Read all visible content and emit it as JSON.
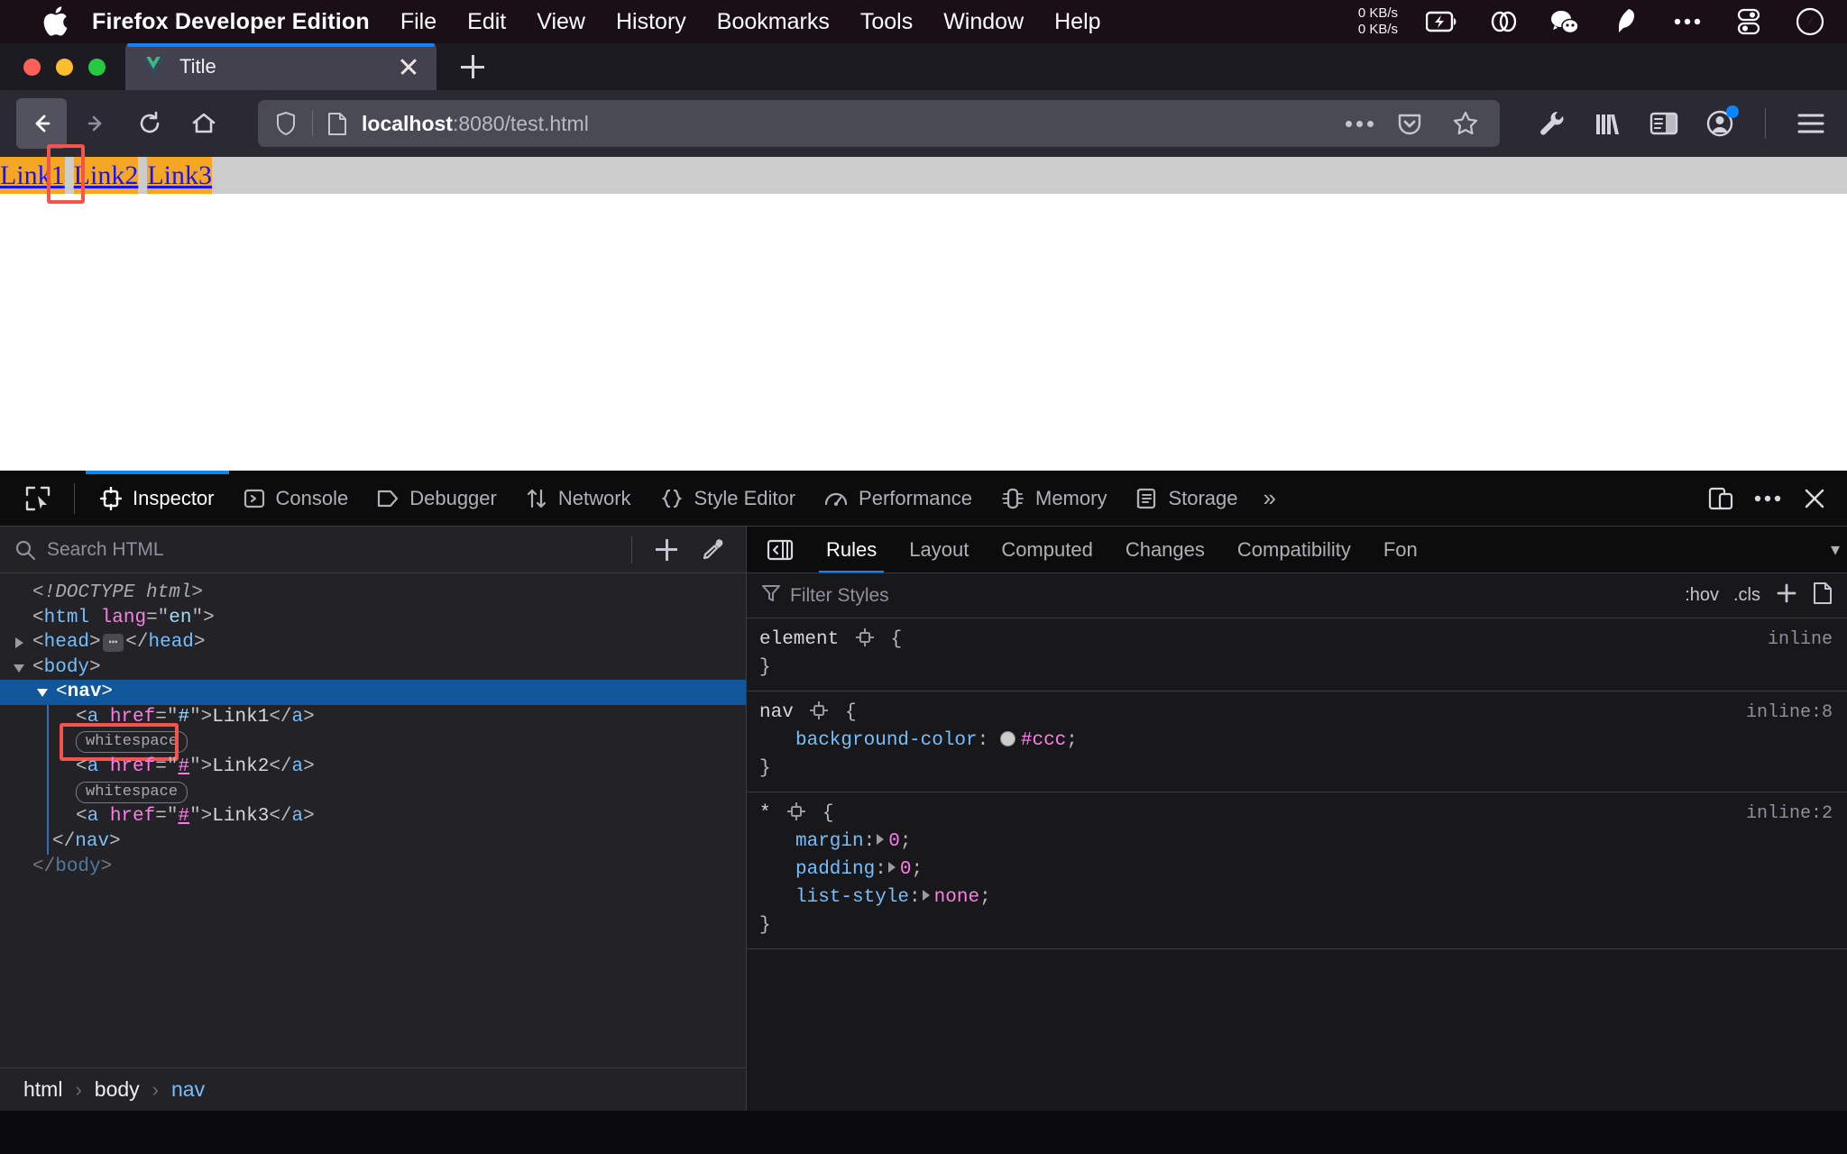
{
  "menubar": {
    "apple_icon": "apple-logo-icon",
    "app_name": "Firefox Developer Edition",
    "items": [
      "File",
      "Edit",
      "View",
      "History",
      "Bookmarks",
      "Tools",
      "Window",
      "Help"
    ],
    "network_up": "0 KB/s",
    "network_down": "0 KB/s",
    "tray_icons": [
      "battery-charging-icon",
      "link-chain-icon",
      "wechat-icon",
      "feather-icon",
      "ellipsis-icon",
      "toggle-stack-icon",
      "control-center-icon"
    ]
  },
  "browser": {
    "tab": {
      "favicon": "vue-logo-icon",
      "title": "Title",
      "close_icon": "close-icon"
    },
    "new_tab_icon": "plus-icon",
    "nav": {
      "back_icon": "arrow-left-icon",
      "forward_icon": "arrow-right-icon",
      "reload_icon": "reload-icon",
      "home_icon": "home-icon"
    },
    "urlbar": {
      "shield_icon": "shield-icon",
      "page_icon": "page-icon",
      "host": "localhost",
      "path": ":8080/test.html",
      "actions": [
        "ellipsis-icon",
        "pocket-icon",
        "star-icon"
      ]
    },
    "toolbar_right": [
      "wrench-icon",
      "library-icon",
      "sidebar-icon",
      "account-icon",
      "hamburger-menu-icon"
    ]
  },
  "page": {
    "nav_background": "#cccccc",
    "link_highlight": "#f5a623",
    "link_color": "#1414ff",
    "links": [
      "Link1",
      "Link2",
      "Link3"
    ],
    "selection_color": "#f4544c"
  },
  "devtools": {
    "picker_icon": "element-picker-icon",
    "tabs": [
      {
        "label": "Inspector",
        "icon": "inspector-icon",
        "active": true
      },
      {
        "label": "Console",
        "icon": "console-icon",
        "active": false
      },
      {
        "label": "Debugger",
        "icon": "debugger-icon",
        "active": false
      },
      {
        "label": "Network",
        "icon": "network-icon",
        "active": false
      },
      {
        "label": "Style Editor",
        "icon": "style-editor-icon",
        "active": false
      },
      {
        "label": "Performance",
        "icon": "performance-icon",
        "active": false
      },
      {
        "label": "Memory",
        "icon": "memory-icon",
        "active": false
      },
      {
        "label": "Storage",
        "icon": "storage-icon",
        "active": false
      }
    ],
    "overflow_icon": "chevron-double-right-icon",
    "right_actions": [
      "responsive-design-icon",
      "meatball-menu-icon",
      "close-icon"
    ],
    "search": {
      "placeholder": "Search HTML",
      "search_icon": "search-icon",
      "add_node_icon": "plus-icon",
      "eyedropper_icon": "eyedropper-icon"
    },
    "markup": [
      {
        "indent": 0,
        "twisty": "none",
        "kind": "doctype",
        "text": "<!DOCTYPE html>"
      },
      {
        "indent": 0,
        "twisty": "none",
        "kind": "open_attr",
        "tag": "html",
        "attr": "lang",
        "value": "en"
      },
      {
        "indent": 0,
        "twisty": "closed",
        "kind": "collapsed",
        "tag": "head"
      },
      {
        "indent": 0,
        "twisty": "open",
        "kind": "open",
        "tag": "body"
      },
      {
        "indent": 1,
        "twisty": "open",
        "kind": "open",
        "tag": "nav",
        "selected": true
      },
      {
        "indent": 2,
        "twisty": "none",
        "kind": "anchor",
        "tag": "a",
        "attr": "href",
        "value": "#",
        "text": "Link1"
      },
      {
        "indent": 2,
        "twisty": "none",
        "kind": "whitespace",
        "label": "whitespace",
        "highlighted": true
      },
      {
        "indent": 2,
        "twisty": "none",
        "kind": "anchor",
        "tag": "a",
        "attr": "href",
        "value": "#",
        "text": "Link2",
        "value_link": true
      },
      {
        "indent": 2,
        "twisty": "none",
        "kind": "whitespace",
        "label": "whitespace",
        "highlighted": false
      },
      {
        "indent": 2,
        "twisty": "none",
        "kind": "anchor",
        "tag": "a",
        "attr": "href",
        "value": "#",
        "text": "Link3"
      },
      {
        "indent": 1,
        "twisty": "none",
        "kind": "close",
        "tag": "nav"
      },
      {
        "indent": 0,
        "twisty": "none",
        "kind": "close",
        "tag": "body"
      }
    ],
    "breadcrumbs": [
      "html",
      "body",
      "nav"
    ],
    "right_panel": {
      "toggle_icon": "panel-toggle-icon",
      "tabs": [
        "Rules",
        "Layout",
        "Computed",
        "Changes",
        "Compatibility",
        "Fon"
      ],
      "active_tab": "Rules",
      "overflow_icon": "chevron-down-icon",
      "filter": {
        "placeholder": "Filter Styles",
        "filter_icon": "funnel-icon",
        "hov": ":hov",
        "cls": ".cls",
        "add_icon": "plus-icon",
        "new_rule_icon": "document-icon"
      },
      "rules": [
        {
          "selector": "element",
          "source": "inline",
          "declarations": []
        },
        {
          "selector": "nav",
          "source": "inline:8",
          "declarations": [
            {
              "property": "background-color",
              "value": "#ccc",
              "swatch": "#cccccc",
              "triangle": false
            }
          ]
        },
        {
          "selector": "*",
          "source": "inline:2",
          "declarations": [
            {
              "property": "margin",
              "value": "0",
              "triangle": true
            },
            {
              "property": "padding",
              "value": "0",
              "triangle": true
            },
            {
              "property": "list-style",
              "value": "none",
              "triangle": true
            }
          ]
        }
      ]
    }
  }
}
